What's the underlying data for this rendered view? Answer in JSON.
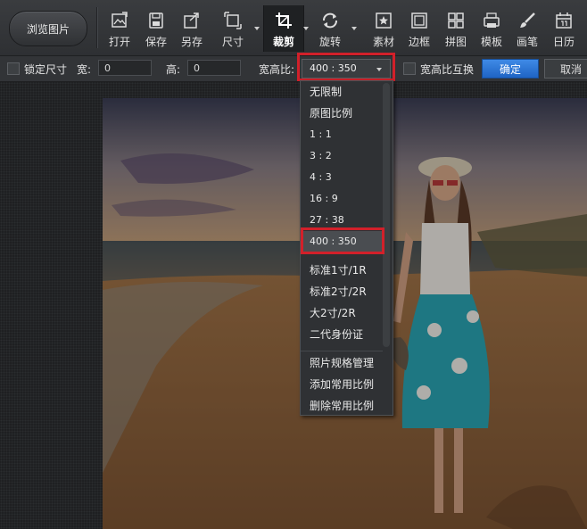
{
  "toolbar": {
    "browse_label": "浏览图片",
    "tools": [
      {
        "label": "打开",
        "icon": "open-image-icon"
      },
      {
        "label": "保存",
        "icon": "save-icon"
      },
      {
        "label": "另存",
        "icon": "save-as-icon"
      },
      {
        "label": "尺寸",
        "icon": "resize-icon"
      },
      {
        "label": "裁剪",
        "icon": "crop-icon",
        "active": true
      },
      {
        "label": "旋转",
        "icon": "rotate-icon"
      },
      {
        "label": "素材",
        "icon": "material-icon"
      },
      {
        "label": "边框",
        "icon": "frame-icon"
      },
      {
        "label": "拼图",
        "icon": "collage-icon"
      },
      {
        "label": "模板",
        "icon": "template-icon"
      },
      {
        "label": "画笔",
        "icon": "brush-icon"
      },
      {
        "label": "日历",
        "icon": "calendar-icon"
      }
    ]
  },
  "options": {
    "lock_size_label": "锁定尺寸",
    "width_label": "宽:",
    "width_value": "0",
    "height_label": "高:",
    "height_value": "0",
    "ratio_label": "宽高比:",
    "ratio_value": "400 : 350",
    "swap_label": "宽高比互换",
    "confirm_label": "确定",
    "cancel_label": "取消"
  },
  "ratio_dropdown": {
    "items": [
      "无限制",
      "原图比例",
      "1 : 1",
      "3 : 2",
      "4 : 3",
      "16 : 9",
      "27 : 38",
      "400 : 350",
      "标准1寸/1R",
      "标准2寸/2R",
      "大2寸/2R",
      "二代身份证"
    ],
    "selected": "400 : 350",
    "actions": [
      "照片规格管理",
      "添加常用比例",
      "删除常用比例"
    ]
  },
  "colors": {
    "highlight": "#d2202a",
    "confirm": "#2a72d2"
  }
}
